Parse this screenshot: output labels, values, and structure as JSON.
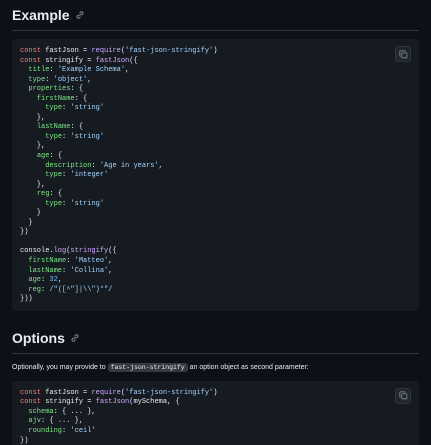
{
  "sections": {
    "example": {
      "title": "Example",
      "code_lines": [
        [
          [
            "kw",
            "const "
          ],
          [
            "pl",
            "fastJson = "
          ],
          [
            "fn",
            "require"
          ],
          [
            "pl",
            "("
          ],
          [
            "str",
            "'fast-json-stringify'"
          ],
          [
            "pl",
            ")"
          ]
        ],
        [
          [
            "kw",
            "const "
          ],
          [
            "pl",
            "stringify = "
          ],
          [
            "fn",
            "fastJson"
          ],
          [
            "pl",
            "({"
          ]
        ],
        [
          [
            "pl",
            "  "
          ],
          [
            "key",
            "title"
          ],
          [
            "pl",
            ": "
          ],
          [
            "str",
            "'Example Schema'"
          ],
          [
            "pl",
            ","
          ]
        ],
        [
          [
            "pl",
            "  "
          ],
          [
            "key",
            "type"
          ],
          [
            "pl",
            ": "
          ],
          [
            "str",
            "'object'"
          ],
          [
            "pl",
            ","
          ]
        ],
        [
          [
            "pl",
            "  "
          ],
          [
            "key",
            "properties"
          ],
          [
            "pl",
            ": {"
          ]
        ],
        [
          [
            "pl",
            "    "
          ],
          [
            "key",
            "firstName"
          ],
          [
            "pl",
            ": {"
          ]
        ],
        [
          [
            "pl",
            "      "
          ],
          [
            "key",
            "type"
          ],
          [
            "pl",
            ": "
          ],
          [
            "str",
            "'string'"
          ]
        ],
        [
          [
            "pl",
            "    },"
          ]
        ],
        [
          [
            "pl",
            "    "
          ],
          [
            "key",
            "lastName"
          ],
          [
            "pl",
            ": {"
          ]
        ],
        [
          [
            "pl",
            "      "
          ],
          [
            "key",
            "type"
          ],
          [
            "pl",
            ": "
          ],
          [
            "str",
            "'string'"
          ]
        ],
        [
          [
            "pl",
            "    },"
          ]
        ],
        [
          [
            "pl",
            "    "
          ],
          [
            "key",
            "age"
          ],
          [
            "pl",
            ": {"
          ]
        ],
        [
          [
            "pl",
            "      "
          ],
          [
            "key",
            "description"
          ],
          [
            "pl",
            ": "
          ],
          [
            "str",
            "'Age in years'"
          ],
          [
            "pl",
            ","
          ]
        ],
        [
          [
            "pl",
            "      "
          ],
          [
            "key",
            "type"
          ],
          [
            "pl",
            ": "
          ],
          [
            "str",
            "'integer'"
          ]
        ],
        [
          [
            "pl",
            "    },"
          ]
        ],
        [
          [
            "pl",
            "    "
          ],
          [
            "key",
            "reg"
          ],
          [
            "pl",
            ": {"
          ]
        ],
        [
          [
            "pl",
            "      "
          ],
          [
            "key",
            "type"
          ],
          [
            "pl",
            ": "
          ],
          [
            "str",
            "'string'"
          ]
        ],
        [
          [
            "pl",
            "    }"
          ]
        ],
        [
          [
            "pl",
            "  }"
          ]
        ],
        [
          [
            "pl",
            "})"
          ]
        ],
        [
          [
            "pl",
            ""
          ]
        ],
        [
          [
            "pl",
            "console."
          ],
          [
            "fn",
            "log"
          ],
          [
            "pl",
            "("
          ],
          [
            "fn",
            "stringify"
          ],
          [
            "pl",
            "({"
          ]
        ],
        [
          [
            "pl",
            "  "
          ],
          [
            "key",
            "firstName"
          ],
          [
            "pl",
            ": "
          ],
          [
            "str",
            "'Matteo'"
          ],
          [
            "pl",
            ","
          ]
        ],
        [
          [
            "pl",
            "  "
          ],
          [
            "key",
            "lastName"
          ],
          [
            "pl",
            ": "
          ],
          [
            "str",
            "'Collina'"
          ],
          [
            "pl",
            ","
          ]
        ],
        [
          [
            "pl",
            "  "
          ],
          [
            "key",
            "age"
          ],
          [
            "pl",
            ": "
          ],
          [
            "num",
            "32"
          ],
          [
            "pl",
            ","
          ]
        ],
        [
          [
            "pl",
            "  "
          ],
          [
            "key",
            "reg"
          ],
          [
            "pl",
            ": "
          ],
          [
            "str",
            "/\"([^\"]|\\\\\")*\"/"
          ]
        ],
        [
          [
            "pl",
            "}))"
          ]
        ]
      ]
    },
    "options": {
      "title": "Options",
      "paragraph_before": "Optionally, you may provide to ",
      "paragraph_code": "fast-json-stringify",
      "paragraph_after": " an option object as second parameter:",
      "code_lines": [
        [
          [
            "kw",
            "const "
          ],
          [
            "pl",
            "fastJson = "
          ],
          [
            "fn",
            "require"
          ],
          [
            "pl",
            "("
          ],
          [
            "str",
            "'fast-json-stringify'"
          ],
          [
            "pl",
            ")"
          ]
        ],
        [
          [
            "kw",
            "const "
          ],
          [
            "pl",
            "stringify = "
          ],
          [
            "fn",
            "fastJson"
          ],
          [
            "pl",
            "(mySchema, {"
          ]
        ],
        [
          [
            "pl",
            "  "
          ],
          [
            "key",
            "schema"
          ],
          [
            "pl",
            ": { ... },"
          ]
        ],
        [
          [
            "pl",
            "  "
          ],
          [
            "key",
            "ajv"
          ],
          [
            "pl",
            ": { ... },"
          ]
        ],
        [
          [
            "pl",
            "  "
          ],
          [
            "key",
            "rounding"
          ],
          [
            "pl",
            ": "
          ],
          [
            "str",
            "'ceil'"
          ]
        ],
        [
          [
            "pl",
            "})"
          ]
        ]
      ]
    }
  },
  "icons": {
    "anchor": "link-icon",
    "copy": "copy-icon"
  },
  "colors": {
    "background": "#0d1117",
    "code_background": "#161b22",
    "keyword": "#ff7b72",
    "string": "#a5d6ff",
    "property": "#7ee787",
    "function": "#d2a8ff",
    "number": "#79c0ff"
  }
}
